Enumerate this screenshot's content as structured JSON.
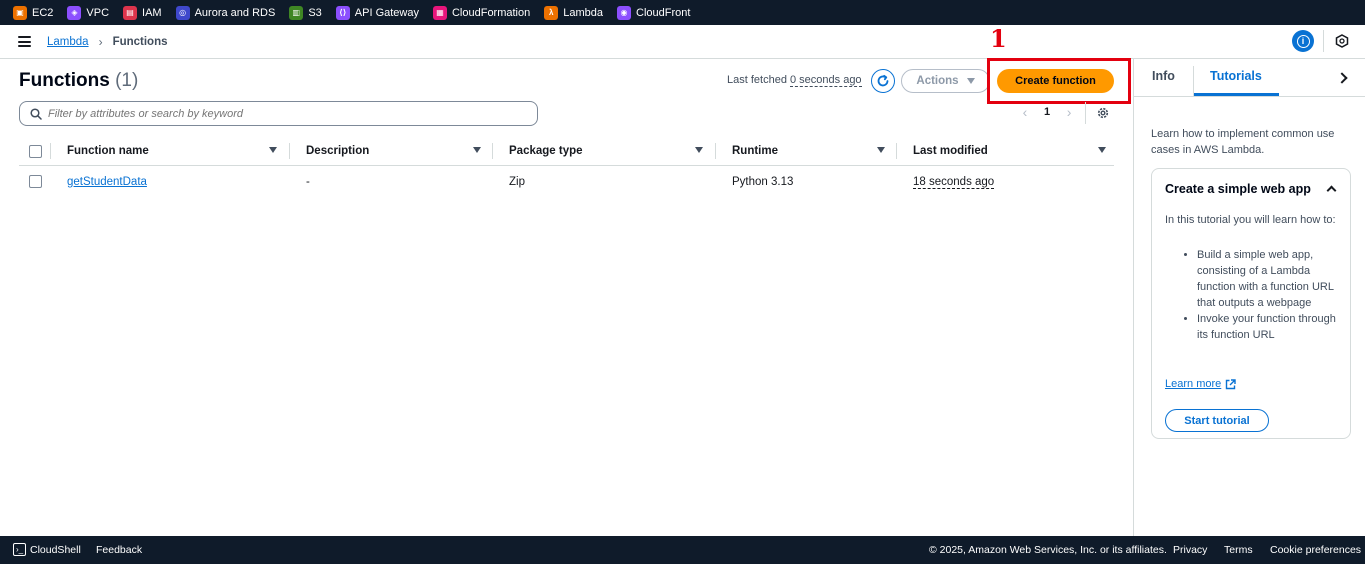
{
  "services": [
    {
      "label": "EC2",
      "icon": "ec2-icon",
      "color": "#ed7100"
    },
    {
      "label": "VPC",
      "icon": "vpc-icon",
      "color": "#8c4fff"
    },
    {
      "label": "IAM",
      "icon": "iam-icon",
      "color": "#dd344c"
    },
    {
      "label": "Aurora and RDS",
      "icon": "rds-icon",
      "color": "#3f48cc"
    },
    {
      "label": "S3",
      "icon": "s3-icon",
      "color": "#3f8624"
    },
    {
      "label": "API Gateway",
      "icon": "api-gateway-icon",
      "color": "#8c4fff"
    },
    {
      "label": "CloudFormation",
      "icon": "cloudformation-icon",
      "color": "#e7157b"
    },
    {
      "label": "Lambda",
      "icon": "lambda-icon",
      "color": "#ed7100"
    },
    {
      "label": "CloudFront",
      "icon": "cloudfront-icon",
      "color": "#8c4fff"
    }
  ],
  "breadcrumb": {
    "parent": "Lambda",
    "current": "Functions"
  },
  "header": {
    "title": "Functions",
    "count": "(1)",
    "last_fetched_prefix": "Last fetched",
    "last_fetched_value": "0 seconds ago",
    "actions_label": "Actions",
    "create_label": "Create function"
  },
  "annotation": {
    "number": "1",
    "color": "#e3000f"
  },
  "search": {
    "placeholder": "Filter by attributes or search by keyword"
  },
  "pagination": {
    "current_page": "1"
  },
  "table": {
    "columns": [
      "Function name",
      "Description",
      "Package type",
      "Runtime",
      "Last modified"
    ],
    "rows": [
      {
        "name": "getStudentData",
        "description": "-",
        "package_type": "Zip",
        "runtime": "Python 3.13",
        "last_modified": "18 seconds ago"
      }
    ]
  },
  "panel": {
    "tab_info": "Info",
    "tab_tutorials": "Tutorials",
    "intro": "Learn how to implement common use cases in AWS Lambda.",
    "card_title": "Create a simple web app",
    "card_body": "In this tutorial you will learn how to:",
    "card_items": [
      "Build a simple web app, consisting of a Lambda function with a function URL that outputs a webpage",
      "Invoke your function through its function URL"
    ],
    "learn_more": "Learn more",
    "start_label": "Start tutorial"
  },
  "footer": {
    "cloudshell": "CloudShell",
    "feedback": "Feedback",
    "copyright": "© 2025, Amazon Web Services, Inc. or its affiliates.",
    "privacy": "Privacy",
    "terms": "Terms",
    "cookies": "Cookie preferences"
  }
}
